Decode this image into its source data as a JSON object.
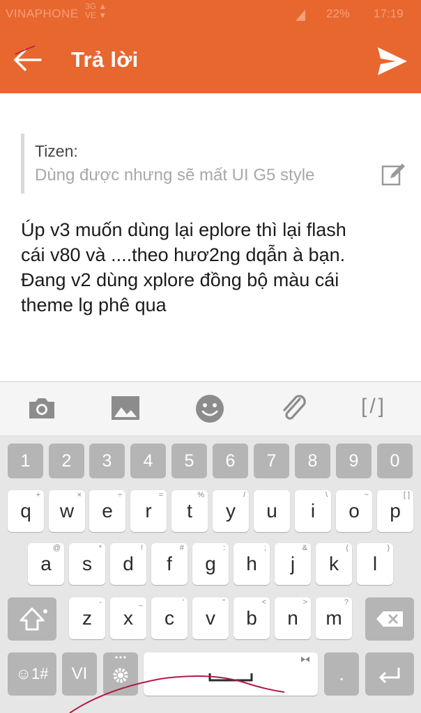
{
  "status_bar": {
    "carrier": "VINAPHONE",
    "network": "3G",
    "battery": "22%",
    "time": "17:19"
  },
  "header": {
    "title": "Trả lời",
    "back_icon": "arrow-left-icon",
    "send_icon": "send-icon",
    "bg_color": "#e8672f"
  },
  "quote": {
    "author": "Tizen:",
    "text": "Dùng được nhưng sẽ mất UI G5 style",
    "edit_icon": "edit-icon"
  },
  "message": {
    "lines": [
      "Úp v3 muốn dùng lại eplore thì lại flash",
      "cái v80 và ....theo hươ2ng dqẫn à bạn.",
      "Đang v2 dùng xplore đồng bộ màu cái",
      "theme lg phê qua"
    ]
  },
  "toolbar": {
    "items": [
      "camera-icon",
      "image-icon",
      "emoji-icon",
      "attachment-icon"
    ],
    "bbcode_label": "[/]"
  },
  "keyboard": {
    "numbers": [
      "1",
      "2",
      "3",
      "4",
      "5",
      "6",
      "7",
      "8",
      "9",
      "0"
    ],
    "row1": [
      {
        "key": "q",
        "sub": "+"
      },
      {
        "key": "w",
        "sub": "×"
      },
      {
        "key": "e",
        "sub": "÷"
      },
      {
        "key": "r",
        "sub": "="
      },
      {
        "key": "t",
        "sub": "%"
      },
      {
        "key": "y",
        "sub": "/"
      },
      {
        "key": "u",
        "sub": ""
      },
      {
        "key": "i",
        "sub": "\\"
      },
      {
        "key": "o",
        "sub": "~"
      },
      {
        "key": "p",
        "sub": "[ ]"
      }
    ],
    "row2": [
      {
        "key": "a",
        "sub": "@"
      },
      {
        "key": "s",
        "sub": "*"
      },
      {
        "key": "d",
        "sub": "!"
      },
      {
        "key": "f",
        "sub": "#"
      },
      {
        "key": "g",
        "sub": ":"
      },
      {
        "key": "h",
        "sub": ";"
      },
      {
        "key": "j",
        "sub": "&"
      },
      {
        "key": "k",
        "sub": "("
      },
      {
        "key": "l",
        "sub": ")"
      }
    ],
    "row3": [
      {
        "key": "z",
        "sub": "-"
      },
      {
        "key": "x",
        "sub": "_"
      },
      {
        "key": "c",
        "sub": "'"
      },
      {
        "key": "v",
        "sub": "\""
      },
      {
        "key": "b",
        "sub": "<"
      },
      {
        "key": "n",
        "sub": ">"
      },
      {
        "key": "m",
        "sub": "?"
      }
    ],
    "symbols_label": "☺1#",
    "language_label": "VI",
    "period_label": ".",
    "shift_icon": "shift-icon",
    "backspace_icon": "backspace-icon",
    "settings_icon": "gear-icon",
    "enter_icon": "enter-icon",
    "space_icon": "space-bar-icon"
  }
}
